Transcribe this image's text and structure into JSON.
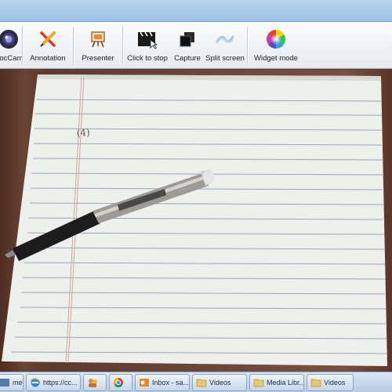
{
  "toolbar": {
    "items": [
      {
        "label": "DocCam",
        "icon": "lens-icon"
      },
      {
        "label": "Annotation",
        "icon": "pencil-icon"
      },
      {
        "label": "Presenter",
        "icon": "easel-icon"
      },
      {
        "label": "Click to stop",
        "icon": "clapper-icon"
      },
      {
        "label": "Capture",
        "icon": "capture-icon"
      },
      {
        "label": "Split screen",
        "icon": "split-screen-icon"
      },
      {
        "label": "Widget mode",
        "icon": "color-wheel-icon"
      }
    ]
  },
  "camera": {
    "paper_marking": "(4)"
  },
  "taskbar": {
    "items": [
      {
        "label": "metic ...",
        "icon": "app-icon"
      },
      {
        "label": "https://cc...",
        "icon": "ie-icon"
      },
      {
        "label": "",
        "icon": "people-icon"
      },
      {
        "label": "",
        "icon": "chrome-icon"
      },
      {
        "label": "Inbox - sa...",
        "icon": "outlook-icon"
      },
      {
        "label": "Videos",
        "icon": "folder-icon"
      },
      {
        "label": "Media Libr...",
        "icon": "folder-icon"
      },
      {
        "label": "Videos",
        "icon": "folder-icon"
      }
    ]
  },
  "colors": {
    "toolbar_bg": "#f0f3f6",
    "titlebar": "#a9c8e8",
    "desk": "#5c3a2c",
    "paper": "#eef0ee",
    "paper_line": "#9aa6b4",
    "taskbar": "#c8d9ec"
  }
}
